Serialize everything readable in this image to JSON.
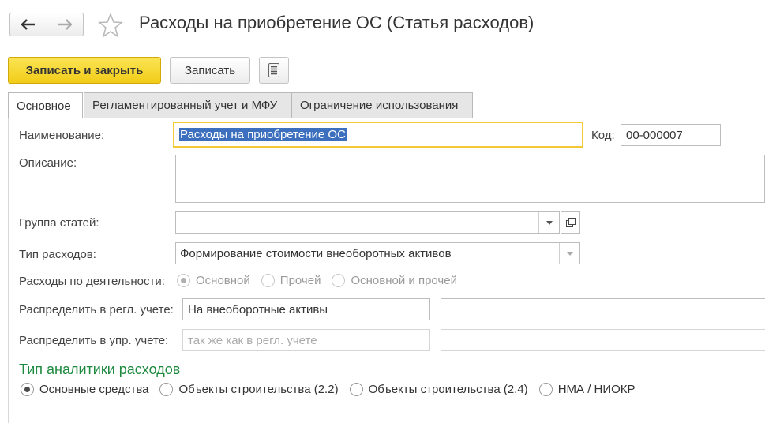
{
  "window": {
    "title": "Расходы на приобретение ОС (Статья расходов)"
  },
  "toolbar": {
    "save_close_label": "Записать и закрыть",
    "save_label": "Записать"
  },
  "tabs": [
    {
      "label": "Основное",
      "active": true
    },
    {
      "label": "Регламентированный учет и МФУ",
      "active": false
    },
    {
      "label": "Ограничение использования",
      "active": false
    }
  ],
  "form": {
    "name": {
      "label": "Наименование:",
      "value": "Расходы на приобретение ОС"
    },
    "code": {
      "label": "Код:",
      "value": "00-000007"
    },
    "description": {
      "label": "Описание:",
      "value": ""
    },
    "group": {
      "label": "Группа статей:",
      "value": ""
    },
    "expense_type": {
      "label": "Тип расходов:",
      "value": "Формирование стоимости внеоборотных активов"
    },
    "activity": {
      "label": "Расходы по деятельности:",
      "options": [
        "Основной",
        "Прочей",
        "Основной и прочей"
      ],
      "selected": 0
    },
    "distribute_reg": {
      "label": "Распределить в регл. учете:",
      "value": "На внеоборотные активы",
      "extra": ""
    },
    "distribute_mgmt": {
      "label": "Распределить в упр. учете:",
      "placeholder": "так же как в регл. учете",
      "extra": ""
    }
  },
  "analytics": {
    "title": "Тип аналитики расходов",
    "options": [
      "Основные средства",
      "Объекты строительства (2.2)",
      "Объекты строительства (2.4)",
      "НМА / НИОКР"
    ],
    "selected": 0
  },
  "colors": {
    "accent_yellow": "#f2cc17",
    "section_green": "#1d8a3f",
    "selection_blue": "#3c6fbe",
    "focus_border": "#f5c935"
  }
}
